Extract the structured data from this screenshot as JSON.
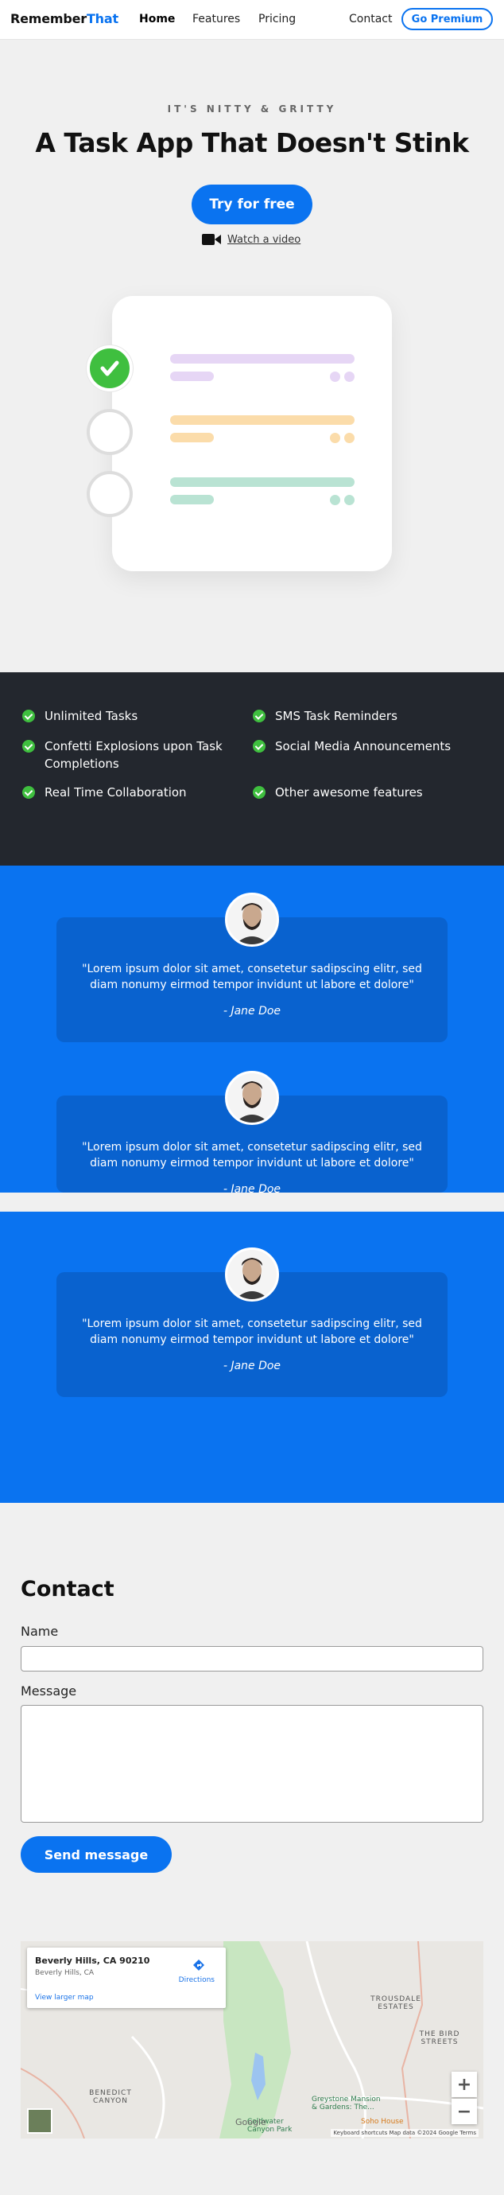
{
  "nav": {
    "brand_part1": "Remember",
    "brand_part2": "That",
    "links": [
      "Home",
      "Features",
      "Pricing",
      "Contact"
    ],
    "premium": "Go Premium"
  },
  "hero": {
    "eyebrow": "IT'S NITTY & GRITTY",
    "title": "A Task App That Doesn't Stink",
    "cta": "Try for free",
    "watch": "Watch a video"
  },
  "illustration": {
    "rows": [
      {
        "bar_color": "#e6d6f5",
        "dot_color": "#e6d6f5",
        "checked": true
      },
      {
        "bar_color": "#fbdcaa",
        "dot_color": "#fbdcaa",
        "checked": false
      },
      {
        "bar_color": "#b9e3d3",
        "dot_color": "#b9e3d3",
        "checked": false
      }
    ],
    "check_color": "#3fbf3f"
  },
  "features": [
    "Unlimited Tasks",
    "SMS Task Reminders",
    "Confetti Explosions upon Task Completions",
    "Social Media Announcements",
    "Real Time Collaboration",
    "Other awesome features"
  ],
  "testimonials": [
    {
      "quote": "\"Lorem ipsum dolor sit amet, consetetur sadipscing elitr, sed diam nonumy eirmod tempor invidunt ut labore et dolore\"",
      "author": "- Jane Doe"
    },
    {
      "quote": "\"Lorem ipsum dolor sit amet, consetetur sadipscing elitr, sed diam nonumy eirmod tempor invidunt ut labore et dolore\"",
      "author": "- Jane Doe"
    },
    {
      "quote": "\"Lorem ipsum dolor sit amet, consetetur sadipscing elitr, sed diam nonumy eirmod tempor invidunt ut labore et dolore\"",
      "author": "- Jane Doe"
    }
  ],
  "contact": {
    "title": "Contact",
    "name_label": "Name",
    "message_label": "Message",
    "send": "Send message"
  },
  "map": {
    "place": "Beverly Hills, CA 90210",
    "sub": "Beverly Hills, CA",
    "directions": "Directions",
    "larger": "View larger map",
    "label_trousdale": "TROUSDALE ESTATES",
    "label_bird": "THE BIRD STREETS",
    "label_benedict": "BENEDICT CANYON",
    "label_greystone": "Greystone Mansion & Gardens: The...",
    "label_coldwater": "Coldwater Canyon Park",
    "label_soho": "Soho House",
    "footer": "Keyboard shortcuts   Map data ©2024 Google   Terms",
    "google": "Google",
    "zoom_in": "+",
    "zoom_out": "−"
  },
  "colors": {
    "accent": "#0a73f0",
    "dark": "#23272e",
    "success": "#3fbf3f"
  }
}
